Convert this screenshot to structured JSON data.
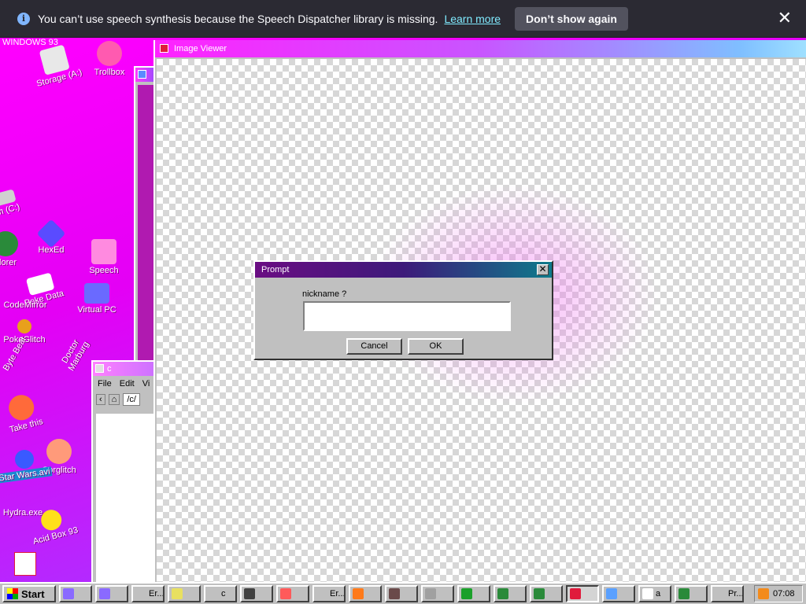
{
  "notification": {
    "message": "You can’t use speech synthesis because the Speech Dispatcher library is missing.",
    "learn_more": "Learn more",
    "dont_show": "Don’t show again",
    "close_glyph": "✕",
    "info_glyph": "i"
  },
  "desktop": {
    "title": "WINDOWS 93",
    "icons": [
      {
        "label": "Storage (A:)",
        "color": "#e8e8e8"
      },
      {
        "label": "Trollbox",
        "color": "#ff5ab0"
      },
      {
        "label": "em (C:)",
        "color": "#d0d0d0"
      },
      {
        "label": "plorer",
        "color": "#2a8a3a"
      },
      {
        "label": "HexEd",
        "color": "#5a4bff"
      },
      {
        "label": "Speech",
        "color": "#ff8ae0"
      },
      {
        "label": "Poke Data",
        "color": "#ffffff"
      },
      {
        "label": "CodeMirror",
        "color": "#ffffff"
      },
      {
        "label": "Virtual PC",
        "color": "#6a6aff"
      },
      {
        "label": "PokeGlitch",
        "color": "#e8a01c"
      },
      {
        "label": "Doctor Marburg",
        "color": "#ff9adf"
      },
      {
        "label": "Byte Beat",
        "color": "#1a8a2a"
      },
      {
        "label": "Take this",
        "color": "#ff6a3a"
      },
      {
        "label": "Corglitch",
        "color": "#ff9a7a"
      },
      {
        "label": "Star Wars.avi",
        "color": "#3a5aff"
      },
      {
        "label": "Hydra.exe",
        "color": "#2a9a3a"
      },
      {
        "label": "Acid Box 93",
        "color": "#ffe01a"
      }
    ]
  },
  "explorer": {
    "title": "c",
    "menu": [
      "File",
      "Edit",
      "Vi"
    ],
    "path": "/c/"
  },
  "viewer": {
    "title": "Image Viewer"
  },
  "prompt": {
    "title": "Prompt",
    "label": "nickname ?",
    "value": "",
    "cancel": "Cancel",
    "ok": "OK",
    "close_glyph": "✕"
  },
  "taskbar": {
    "start": "Start",
    "tasks": [
      {
        "label": "",
        "color": "#8a6aff"
      },
      {
        "label": "",
        "color": "#8a6aff"
      },
      {
        "label": "Er...",
        "color": "#c0c0c0"
      },
      {
        "label": "",
        "color": "#e8e060"
      },
      {
        "label": "c",
        "color": "#c0c0c0"
      },
      {
        "label": "",
        "color": "#404040"
      },
      {
        "label": "",
        "color": "#ff5a5a"
      },
      {
        "label": "Er...",
        "color": "#c0c0c0"
      },
      {
        "label": "",
        "color": "#ff7a1a"
      },
      {
        "label": "",
        "color": "#6a4a4a"
      },
      {
        "label": "",
        "color": "#a0a0a0"
      },
      {
        "label": "",
        "color": "#1aa02a"
      },
      {
        "label": "",
        "color": "#2a8a3a"
      },
      {
        "label": "",
        "color": "#2a8a3a"
      },
      {
        "label": "",
        "color": "#e01b3c"
      },
      {
        "label": "",
        "color": "#5aa0ff"
      },
      {
        "label": "a",
        "color": "#ffffff"
      },
      {
        "label": "",
        "color": "#2a8a3a"
      },
      {
        "label": "Pr...",
        "color": "#c0c0c0"
      }
    ],
    "clock": "07:08"
  }
}
